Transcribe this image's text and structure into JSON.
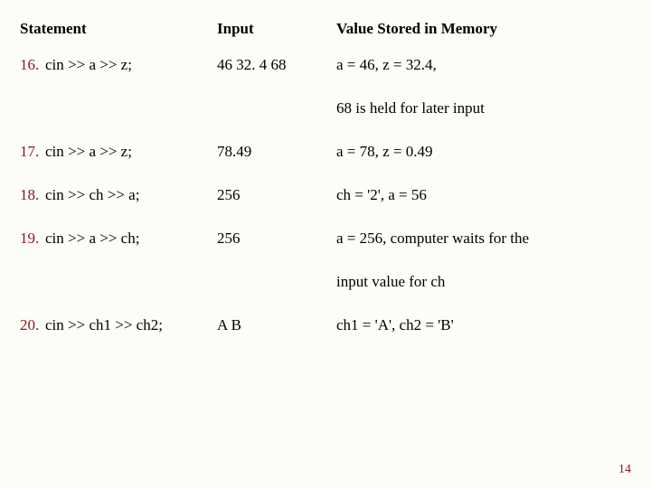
{
  "header": {
    "statement": "Statement",
    "input": "Input",
    "value": "Value Stored in Memory"
  },
  "rows": {
    "r16": {
      "num": "16.",
      "stmt": "cin >> a >> z;",
      "input": "46 32. 4 68",
      "value": "a = 46, z = 32.4,"
    },
    "r16b": {
      "value": "68 is held for later input"
    },
    "r17": {
      "num": "17.",
      "stmt": "cin >> a >> z;",
      "input": "78.49",
      "value": "a = 78, z = 0.49"
    },
    "r18": {
      "num": "18.",
      "stmt": "cin >> ch >> a;",
      "input": "256",
      "value": "ch = '2', a = 56"
    },
    "r19": {
      "num": "19.",
      "stmt": "cin >> a >> ch;",
      "input": "256",
      "value": "a = 256, computer waits for the"
    },
    "r19b": {
      "value": "input value for ch"
    },
    "r20": {
      "num": "20.",
      "stmt": "cin >> ch1 >> ch2;",
      "input": "A B",
      "value": "ch1 = 'A', ch2 = 'B'"
    }
  },
  "pageNumber": "14"
}
